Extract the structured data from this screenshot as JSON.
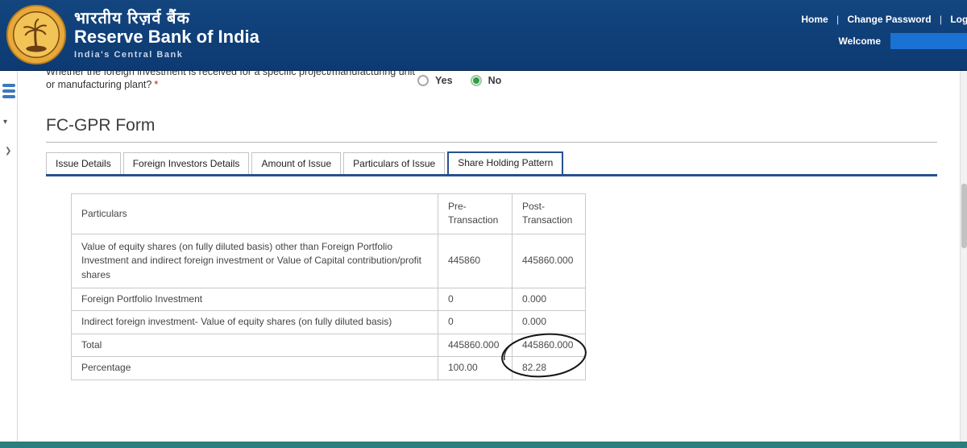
{
  "header": {
    "bank_name_hindi": "भारतीय रिज़र्व बैंक",
    "bank_name_english": "Reserve Bank of India",
    "tagline": "India's Central Bank",
    "nav_items": [
      "Home",
      "Change Password",
      "Logout"
    ],
    "nav_separator": "|",
    "welcome_label": "Welcome"
  },
  "question": {
    "line1": "Whether the foreign investment is received for a specific project/manufacturing unit",
    "line2": "or manufacturing plant?",
    "required_marker": "*",
    "options": [
      {
        "label": "Yes",
        "selected": false
      },
      {
        "label": "No",
        "selected": true
      }
    ]
  },
  "form": {
    "title": "FC-GPR Form",
    "tabs": [
      {
        "label": "Issue Details",
        "active": false
      },
      {
        "label": "Foreign Investors Details",
        "active": false
      },
      {
        "label": "Amount of Issue",
        "active": false
      },
      {
        "label": "Particulars of Issue",
        "active": false
      },
      {
        "label": "Share Holding Pattern",
        "active": true
      }
    ]
  },
  "table": {
    "headers": [
      "Particulars",
      "Pre-Transaction",
      "Post-Transaction"
    ],
    "rows": [
      {
        "particulars": "Value of equity shares (on fully diluted basis) other than Foreign Portfolio Investment and indirect foreign investment or Value of Capital contribution/profit shares",
        "pre": "445860",
        "post": "445860.000"
      },
      {
        "particulars": "Foreign Portfolio Investment",
        "pre": "0",
        "post": "0.000"
      },
      {
        "particulars": "Indirect foreign investment- Value of equity shares (on fully diluted basis)",
        "pre": "0",
        "post": "0.000"
      },
      {
        "particulars": "Total",
        "pre": "445860.000",
        "post": "445860.000"
      },
      {
        "particulars": "Percentage",
        "pre": "100.00",
        "post": "82.28",
        "annotated": true
      }
    ]
  },
  "colors": {
    "header_navy": "#0d3a72",
    "accent_blue": "#27518f",
    "redacted_blue": "#1a72d4",
    "radio_green": "#2f9e44",
    "footer_teal": "#2a7e7e",
    "logo_gold": "#e8a93b"
  }
}
